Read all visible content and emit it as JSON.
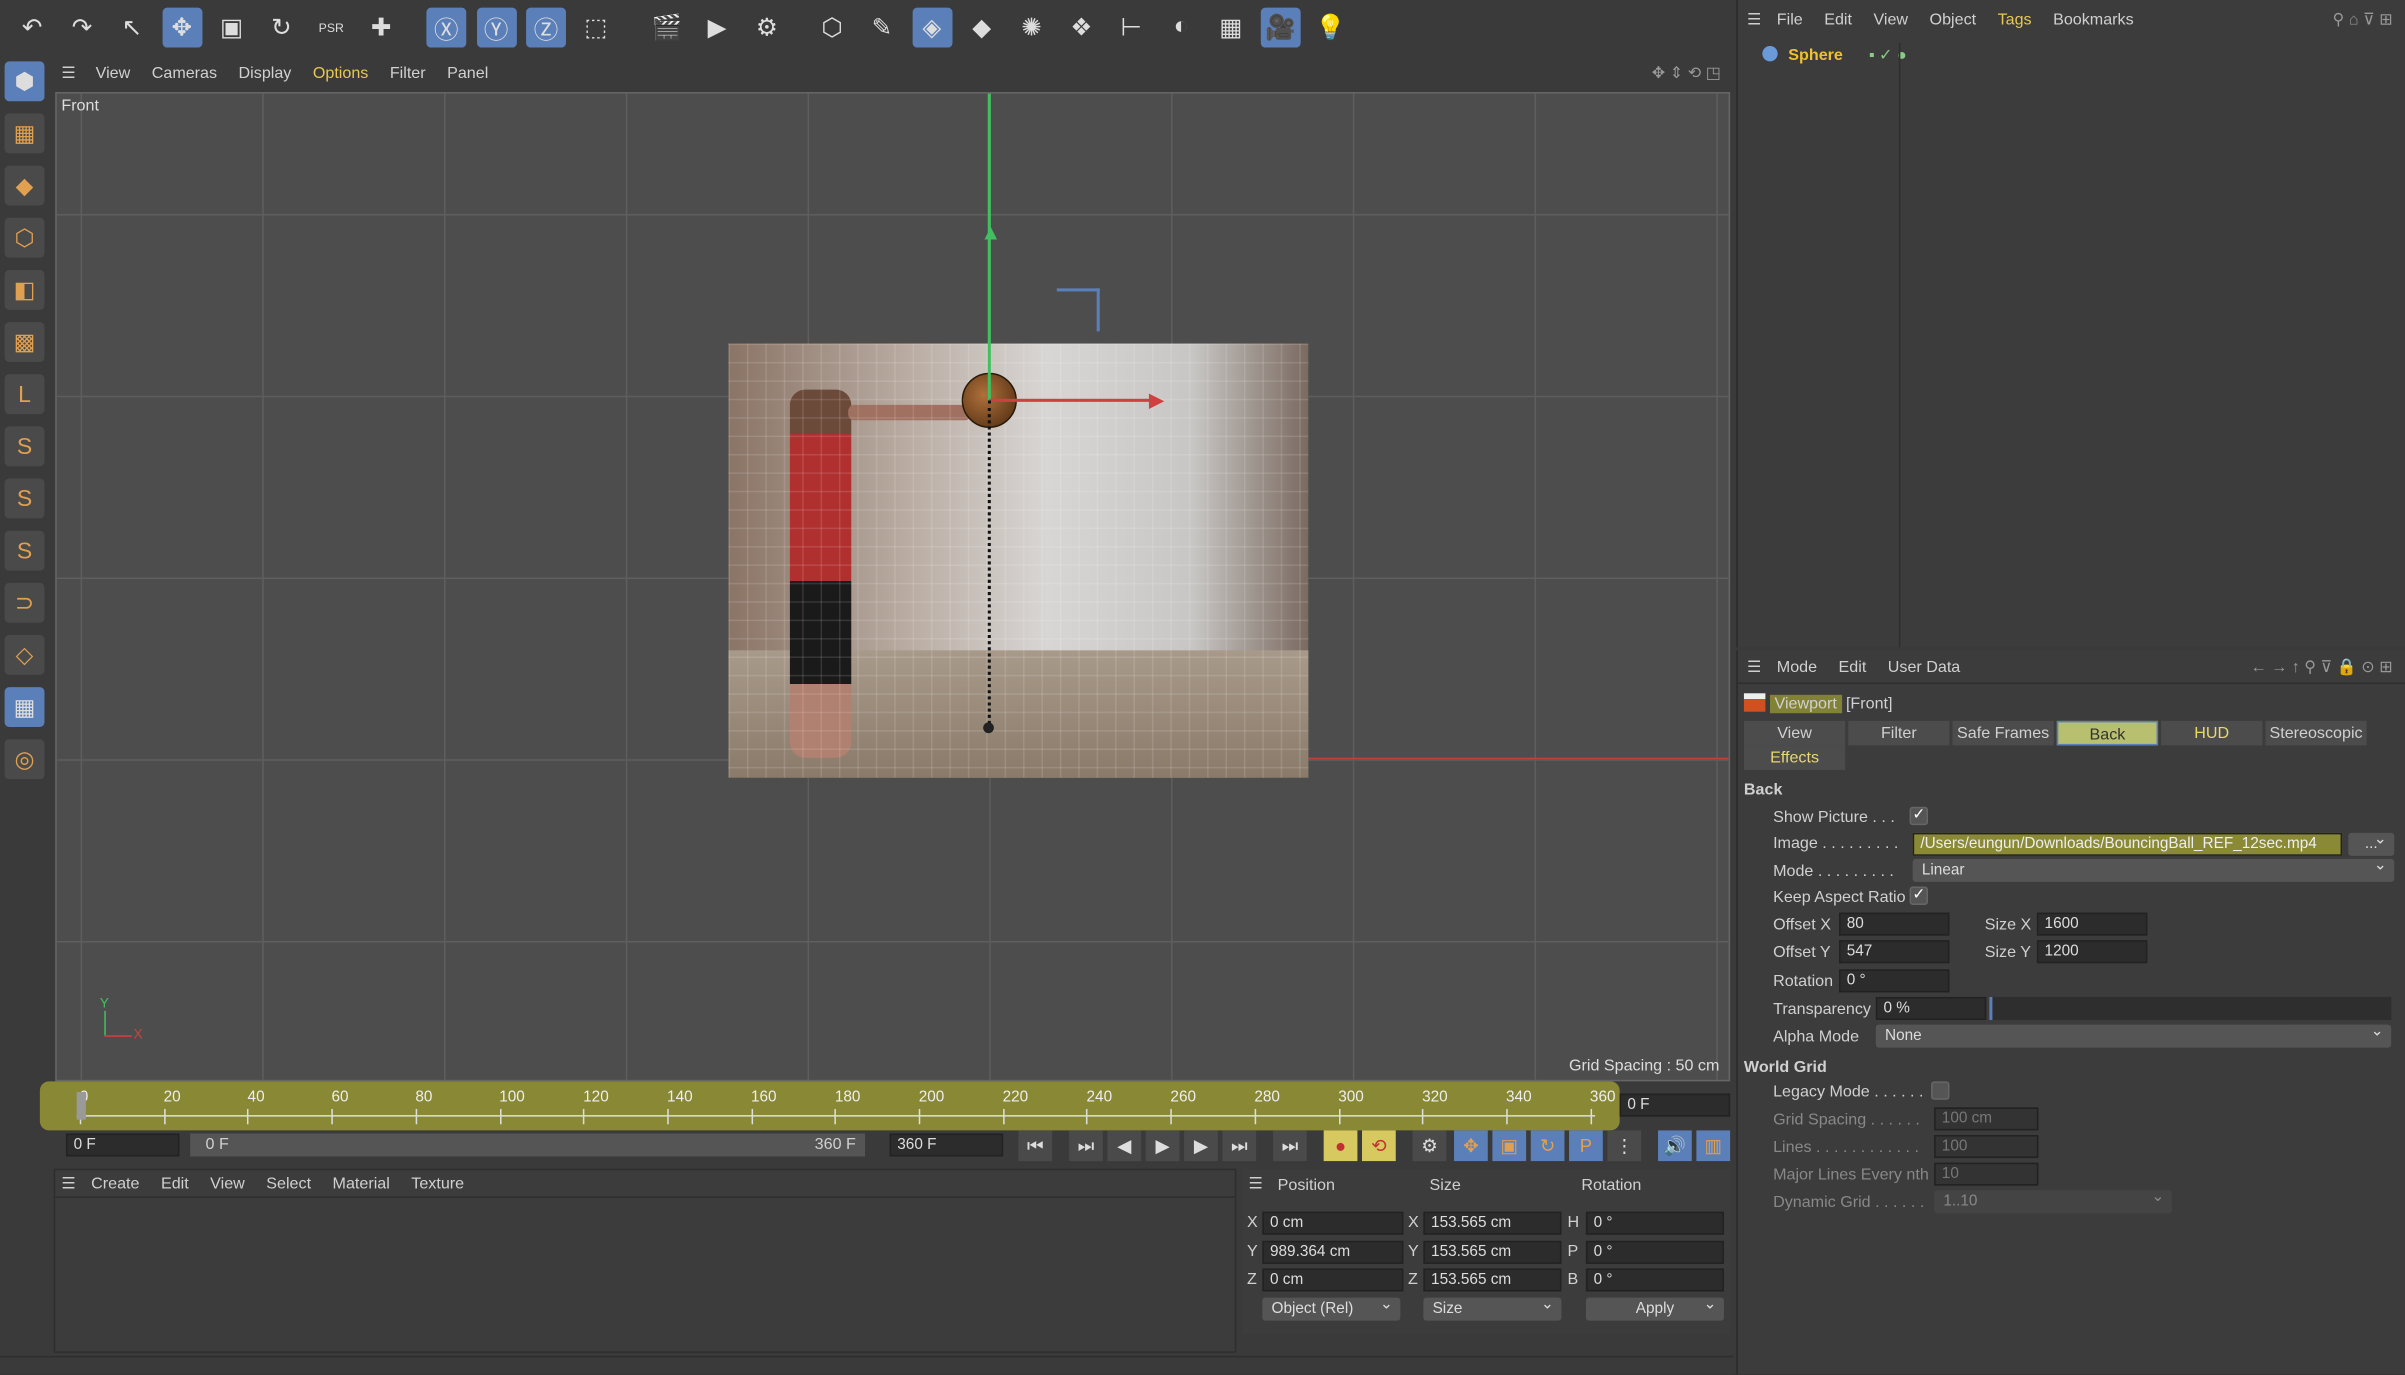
{
  "top_toolbar": {
    "icons": [
      "undo-icon",
      "redo-icon",
      "select-icon",
      "move-icon",
      "scale-icon",
      "rotate-icon",
      "psr-icon",
      "add-icon",
      "x-axis-icon",
      "y-axis-icon",
      "z-axis-icon",
      "coordinate-system-icon",
      "render-view-icon",
      "render-icon",
      "render-settings-icon",
      "cube-icon",
      "pen-icon",
      "subdivision-icon",
      "extrude-icon",
      "mograph-icon",
      "cloner-icon",
      "deformer-icon",
      "field-icon",
      "floor-icon",
      "camera-icon",
      "light-icon"
    ],
    "glyphs": [
      "↶",
      "↷",
      "↖",
      "✥",
      "▣",
      "↻",
      "PSR",
      "✚",
      "Ⓧ",
      "Ⓨ",
      "Ⓩ",
      "⬚",
      "🎬",
      "▶",
      "⚙",
      "⬡",
      "✎",
      "◈",
      "◆",
      "✺",
      "❖",
      "⊢",
      "◐",
      "▦",
      "🎥",
      "💡"
    ]
  },
  "viewport": {
    "menu": [
      "View",
      "Cameras",
      "Display",
      "Options",
      "Filter",
      "Panel"
    ],
    "label": "Front",
    "grid_spacing": "Grid Spacing : 50 cm",
    "axis_y": "Y",
    "axis_x": "X"
  },
  "left_toolbar": {
    "glyphs": [
      "⬢",
      "▦",
      "◆",
      "⬡",
      "◧",
      "▩",
      "L",
      "S",
      "S",
      "S",
      "⊃",
      "◇",
      "▦",
      "◎"
    ]
  },
  "timeline": {
    "ticks": [
      "0",
      "20",
      "40",
      "60",
      "80",
      "100",
      "120",
      "140",
      "160",
      "180",
      "200",
      "220",
      "240",
      "260",
      "280",
      "300",
      "320",
      "340",
      "360"
    ],
    "current_frame": "0 F",
    "start": "0 F",
    "range_start": "0 F",
    "range_end": "360 F",
    "end": "360 F"
  },
  "playback": {
    "glyphs": [
      "⏮",
      "⏭",
      "◀",
      "▶",
      "▶",
      "⏭",
      "⏭",
      "●",
      "⟲",
      "⚙",
      "✥",
      "▣",
      "↻",
      "P",
      "⋮",
      "🔊",
      "▥"
    ]
  },
  "material_manager": {
    "menu": [
      "Create",
      "Edit",
      "View",
      "Select",
      "Material",
      "Texture"
    ]
  },
  "coordinates": {
    "headers": [
      "Position",
      "Size",
      "Rotation"
    ],
    "rows": [
      {
        "axis": "X",
        "pos": "0 cm",
        "size_axis": "X",
        "size": "153.565 cm",
        "rot_axis": "H",
        "rot": "0 °"
      },
      {
        "axis": "Y",
        "pos": "989.364 cm",
        "size_axis": "Y",
        "size": "153.565 cm",
        "rot_axis": "P",
        "rot": "0 °"
      },
      {
        "axis": "Z",
        "pos": "0 cm",
        "size_axis": "Z",
        "size": "153.565 cm",
        "rot_axis": "B",
        "rot": "0 °"
      }
    ],
    "mode": "Object (Rel)",
    "size_mode": "Size",
    "apply": "Apply"
  },
  "object_manager": {
    "menu": [
      "File",
      "Edit",
      "View",
      "Object",
      "Tags",
      "Bookmarks"
    ],
    "objects": [
      {
        "name": "Sphere"
      }
    ]
  },
  "attributes": {
    "menu": [
      "Mode",
      "Edit",
      "User Data"
    ],
    "title": "Viewport",
    "title_suffix": "[Front]",
    "tabs": [
      "View",
      "Filter",
      "Safe Frames",
      "Back",
      "HUD",
      "Stereoscopic",
      "Effects"
    ],
    "active_tab": "Back",
    "section_back": "Back",
    "show_picture_label": "Show Picture . . .",
    "show_picture": true,
    "image_label": "Image . . . . . . . . .",
    "image": "/Users/eungun/Downloads/BouncingBall_REF_12sec.mp4",
    "browse": "...",
    "mode_label": "Mode . . . . . . . . .",
    "mode": "Linear",
    "keep_aspect_label": "Keep Aspect Ratio",
    "keep_aspect": true,
    "offset_x_label": "Offset X",
    "offset_x": "80",
    "size_x_label": "Size X",
    "size_x": "1600",
    "offset_y_label": "Offset Y",
    "offset_y": "547",
    "size_y_label": "Size Y",
    "size_y": "1200",
    "rotation_label": "Rotation",
    "rotation": "0 °",
    "transparency_label": "Transparency",
    "transparency": "0 %",
    "alpha_mode_label": "Alpha Mode",
    "alpha_mode": "None",
    "section_grid": "World Grid",
    "legacy_label": "Legacy Mode . . . . . .",
    "legacy": false,
    "grid_spacing_label": "Grid Spacing . . . . . .",
    "grid_spacing": "100 cm",
    "lines_label": "Lines . . . . . . . . . . . .",
    "lines": "100",
    "major_label": "Major Lines Every nth",
    "major": "10",
    "dynamic_label": "Dynamic Grid . . . . . .",
    "dynamic": "1..10"
  },
  "colors": {
    "highlight": "#c8c832",
    "accent_blue": "#5b7fb8",
    "axis_x": "#d04040",
    "axis_y": "#40c060"
  }
}
